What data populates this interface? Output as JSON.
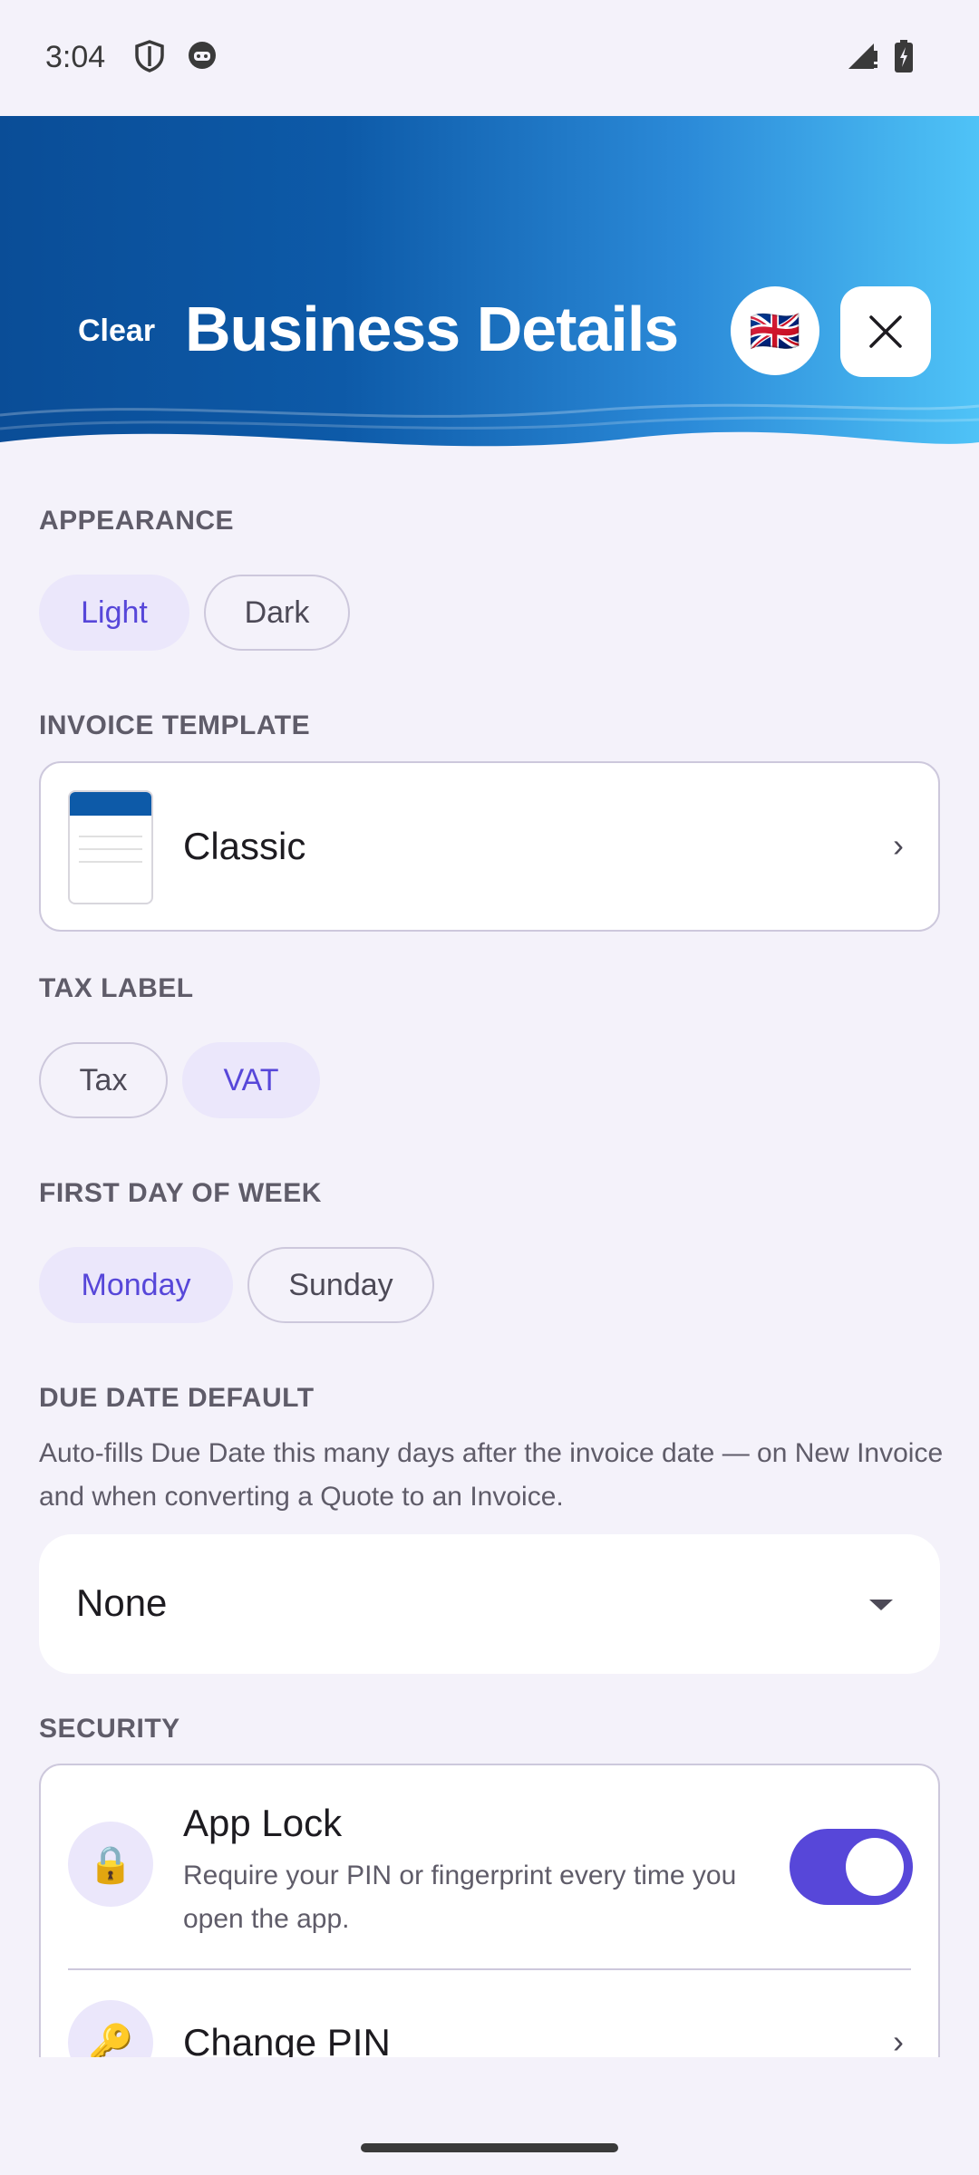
{
  "status_bar": {
    "time": "3:04",
    "icons": [
      "shield-icon",
      "robot-icon",
      "signal-icon",
      "battery-icon"
    ]
  },
  "header": {
    "clear_label": "Clear",
    "title": "Business Details",
    "language_flag": "🇬🇧",
    "close_icon": "close-icon"
  },
  "appearance": {
    "label": "APPEARANCE",
    "options": [
      "Light",
      "Dark"
    ],
    "selected": "Light"
  },
  "invoice_template": {
    "label": "INVOICE TEMPLATE",
    "value": "Classic"
  },
  "tax_label": {
    "label": "TAX LABEL",
    "options": [
      "Tax",
      "VAT"
    ],
    "selected": "VAT"
  },
  "first_day": {
    "label": "FIRST DAY OF WEEK",
    "options": [
      "Monday",
      "Sunday"
    ],
    "selected": "Monday"
  },
  "due_date": {
    "label": "DUE DATE DEFAULT",
    "description": "Auto-fills Due Date this many days after the invoice date — on New Invoice and when converting a Quote to an Invoice.",
    "value": "None"
  },
  "security": {
    "label": "SECURITY",
    "app_lock": {
      "title": "App Lock",
      "description": "Require your PIN or fingerprint every time you open the app.",
      "icon": "🔒",
      "enabled": true
    },
    "change_pin": {
      "title": "Change PIN",
      "icon": "🔑"
    }
  },
  "colors": {
    "accent": "#5747d9",
    "accent_light": "#ebe7fb",
    "header_dark": "#0a4d97",
    "header_light": "#4fc3f7"
  }
}
